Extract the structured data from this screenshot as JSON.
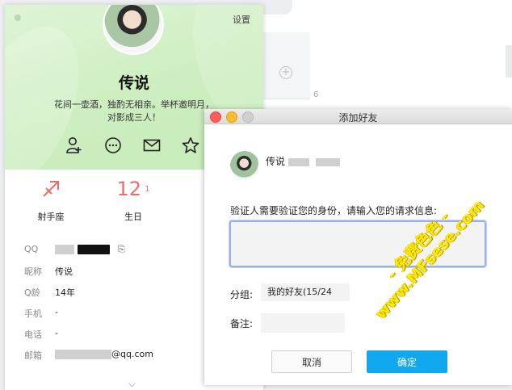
{
  "background": {
    "badge_text": "6"
  },
  "profile": {
    "settings_label": "设置",
    "nickname": "传说",
    "signature": "花间一壶酒，独酌无相亲。举杯邀明月，对影成三人！",
    "stats": [
      {
        "icon": "sagittarius-icon",
        "label": "射手座"
      },
      {
        "icon": "calendar-icon",
        "value_main": "12",
        "value_sub": "1",
        "label": "生日"
      }
    ],
    "info": [
      {
        "key": "QQ",
        "value": ""
      },
      {
        "key": "昵称",
        "value": "传说"
      },
      {
        "key": "Q龄",
        "value": "14年"
      },
      {
        "key": "手机",
        "value": "-"
      },
      {
        "key": "电话",
        "value": "-"
      },
      {
        "key": "邮箱",
        "value": "@qq.com"
      }
    ]
  },
  "dialog": {
    "title": "添加好友",
    "user_name": "传说",
    "prompt": "验证人需要验证您的身份，请输入您的请求信息:",
    "group_label": "分组:",
    "group_value": "我的好友(15/24",
    "remark_label": "备注:",
    "cancel_label": "取消",
    "ok_label": "确定"
  },
  "watermark": {
    "line1": "- 免费色色 -",
    "line2": "www.MFsese.com"
  },
  "colors": {
    "accent": "#12a8f0",
    "profile_header": "#d2efc6",
    "stat_icon": "#f06a6a",
    "watermark": "#ffea00"
  }
}
